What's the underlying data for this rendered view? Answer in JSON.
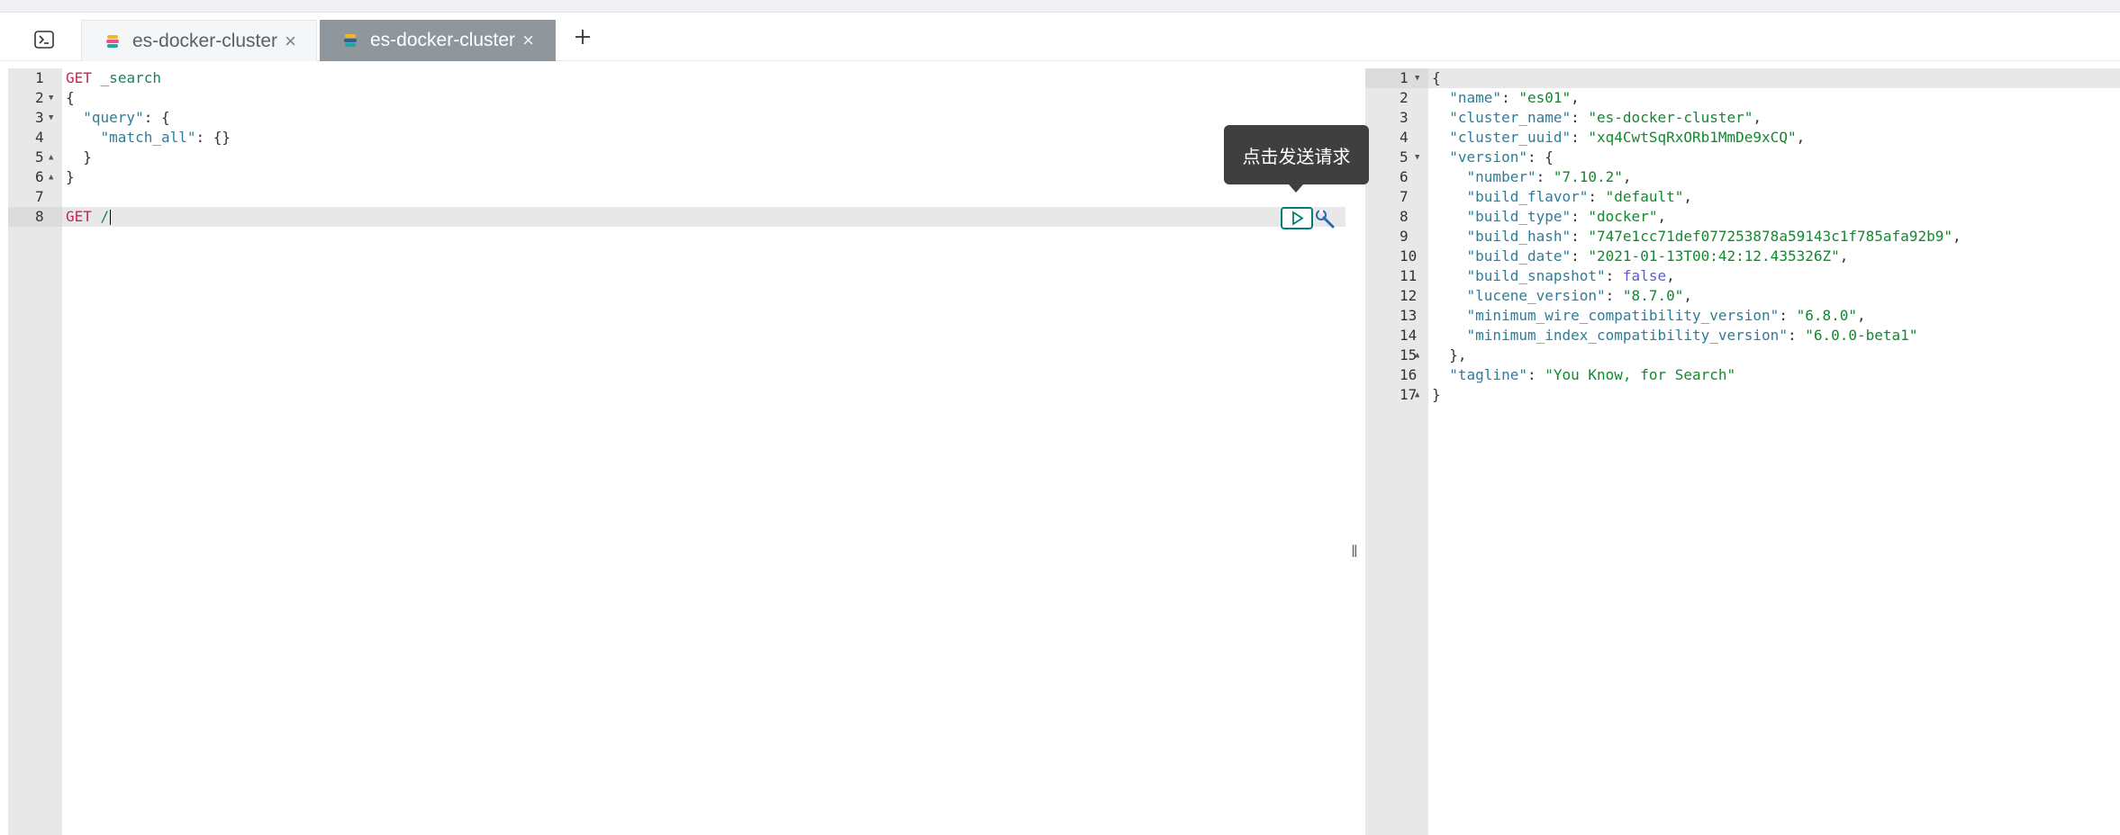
{
  "tabs": [
    {
      "label": "es-docker-cluster",
      "active": false
    },
    {
      "label": "es-docker-cluster",
      "active": true
    }
  ],
  "tooltip": {
    "text": "点击发送请求"
  },
  "request_editor": {
    "lines": [
      {
        "n": "1",
        "tokens": [
          [
            "method",
            "GET"
          ],
          [
            "punct",
            " "
          ],
          [
            "url",
            "_search"
          ]
        ]
      },
      {
        "n": "2",
        "tokens": [
          [
            "punct",
            "{"
          ]
        ]
      },
      {
        "n": "3",
        "tokens": [
          [
            "punct",
            "  "
          ],
          [
            "key",
            "\"query\""
          ],
          [
            "punct",
            ": {"
          ]
        ]
      },
      {
        "n": "4",
        "tokens": [
          [
            "punct",
            "    "
          ],
          [
            "key",
            "\"match_all\""
          ],
          [
            "punct",
            ": {}"
          ]
        ]
      },
      {
        "n": "5",
        "tokens": [
          [
            "punct",
            "  }"
          ]
        ]
      },
      {
        "n": "6",
        "tokens": [
          [
            "punct",
            "}"
          ]
        ]
      },
      {
        "n": "7",
        "tokens": []
      },
      {
        "n": "8",
        "tokens": [
          [
            "method",
            "GET"
          ],
          [
            "punct",
            " "
          ],
          [
            "url",
            "/"
          ]
        ]
      }
    ]
  },
  "response_editor": {
    "lines": [
      {
        "n": "1",
        "tokens": [
          [
            "punct",
            "{"
          ]
        ]
      },
      {
        "n": "2",
        "tokens": [
          [
            "punct",
            "  "
          ],
          [
            "key",
            "\"name\""
          ],
          [
            "punct",
            ": "
          ],
          [
            "str",
            "\"es01\""
          ],
          [
            "punct",
            ","
          ]
        ]
      },
      {
        "n": "3",
        "tokens": [
          [
            "punct",
            "  "
          ],
          [
            "key",
            "\"cluster_name\""
          ],
          [
            "punct",
            ": "
          ],
          [
            "str",
            "\"es-docker-cluster\""
          ],
          [
            "punct",
            ","
          ]
        ]
      },
      {
        "n": "4",
        "tokens": [
          [
            "punct",
            "  "
          ],
          [
            "key",
            "\"cluster_uuid\""
          ],
          [
            "punct",
            ": "
          ],
          [
            "str",
            "\"xq4CwtSqRxORb1MmDe9xCQ\""
          ],
          [
            "punct",
            ","
          ]
        ]
      },
      {
        "n": "5",
        "tokens": [
          [
            "punct",
            "  "
          ],
          [
            "key",
            "\"version\""
          ],
          [
            "punct",
            ": {"
          ]
        ]
      },
      {
        "n": "6",
        "tokens": [
          [
            "punct",
            "    "
          ],
          [
            "key",
            "\"number\""
          ],
          [
            "punct",
            ": "
          ],
          [
            "str",
            "\"7.10.2\""
          ],
          [
            "punct",
            ","
          ]
        ]
      },
      {
        "n": "7",
        "tokens": [
          [
            "punct",
            "    "
          ],
          [
            "key",
            "\"build_flavor\""
          ],
          [
            "punct",
            ": "
          ],
          [
            "str",
            "\"default\""
          ],
          [
            "punct",
            ","
          ]
        ]
      },
      {
        "n": "8",
        "tokens": [
          [
            "punct",
            "    "
          ],
          [
            "key",
            "\"build_type\""
          ],
          [
            "punct",
            ": "
          ],
          [
            "str",
            "\"docker\""
          ],
          [
            "punct",
            ","
          ]
        ]
      },
      {
        "n": "9",
        "tokens": [
          [
            "punct",
            "    "
          ],
          [
            "key",
            "\"build_hash\""
          ],
          [
            "punct",
            ": "
          ],
          [
            "str",
            "\"747e1cc71def077253878a59143c1f785afa92b9\""
          ],
          [
            "punct",
            ","
          ]
        ]
      },
      {
        "n": "10",
        "tokens": [
          [
            "punct",
            "    "
          ],
          [
            "key",
            "\"build_date\""
          ],
          [
            "punct",
            ": "
          ],
          [
            "str",
            "\"2021-01-13T00:42:12.435326Z\""
          ],
          [
            "punct",
            ","
          ]
        ]
      },
      {
        "n": "11",
        "tokens": [
          [
            "punct",
            "    "
          ],
          [
            "key",
            "\"build_snapshot\""
          ],
          [
            "punct",
            ": "
          ],
          [
            "bool",
            "false"
          ],
          [
            "punct",
            ","
          ]
        ]
      },
      {
        "n": "12",
        "tokens": [
          [
            "punct",
            "    "
          ],
          [
            "key",
            "\"lucene_version\""
          ],
          [
            "punct",
            ": "
          ],
          [
            "str",
            "\"8.7.0\""
          ],
          [
            "punct",
            ","
          ]
        ]
      },
      {
        "n": "13",
        "tokens": [
          [
            "punct",
            "    "
          ],
          [
            "key",
            "\"minimum_wire_compatibility_version\""
          ],
          [
            "punct",
            ": "
          ],
          [
            "str",
            "\"6.8.0\""
          ],
          [
            "punct",
            ","
          ]
        ]
      },
      {
        "n": "14",
        "tokens": [
          [
            "punct",
            "    "
          ],
          [
            "key",
            "\"minimum_index_compatibility_version\""
          ],
          [
            "punct",
            ": "
          ],
          [
            "str",
            "\"6.0.0-beta1\""
          ]
        ]
      },
      {
        "n": "15",
        "tokens": [
          [
            "punct",
            "  },"
          ]
        ]
      },
      {
        "n": "16",
        "tokens": [
          [
            "punct",
            "  "
          ],
          [
            "key",
            "\"tagline\""
          ],
          [
            "punct",
            ": "
          ],
          [
            "str",
            "\"You Know, for Search\""
          ]
        ]
      },
      {
        "n": "17",
        "tokens": [
          [
            "punct",
            "}"
          ]
        ]
      }
    ]
  },
  "colors": {
    "accent": "#017d73",
    "active_tab": "#8f969c",
    "gutter": "#e8e8e8"
  }
}
